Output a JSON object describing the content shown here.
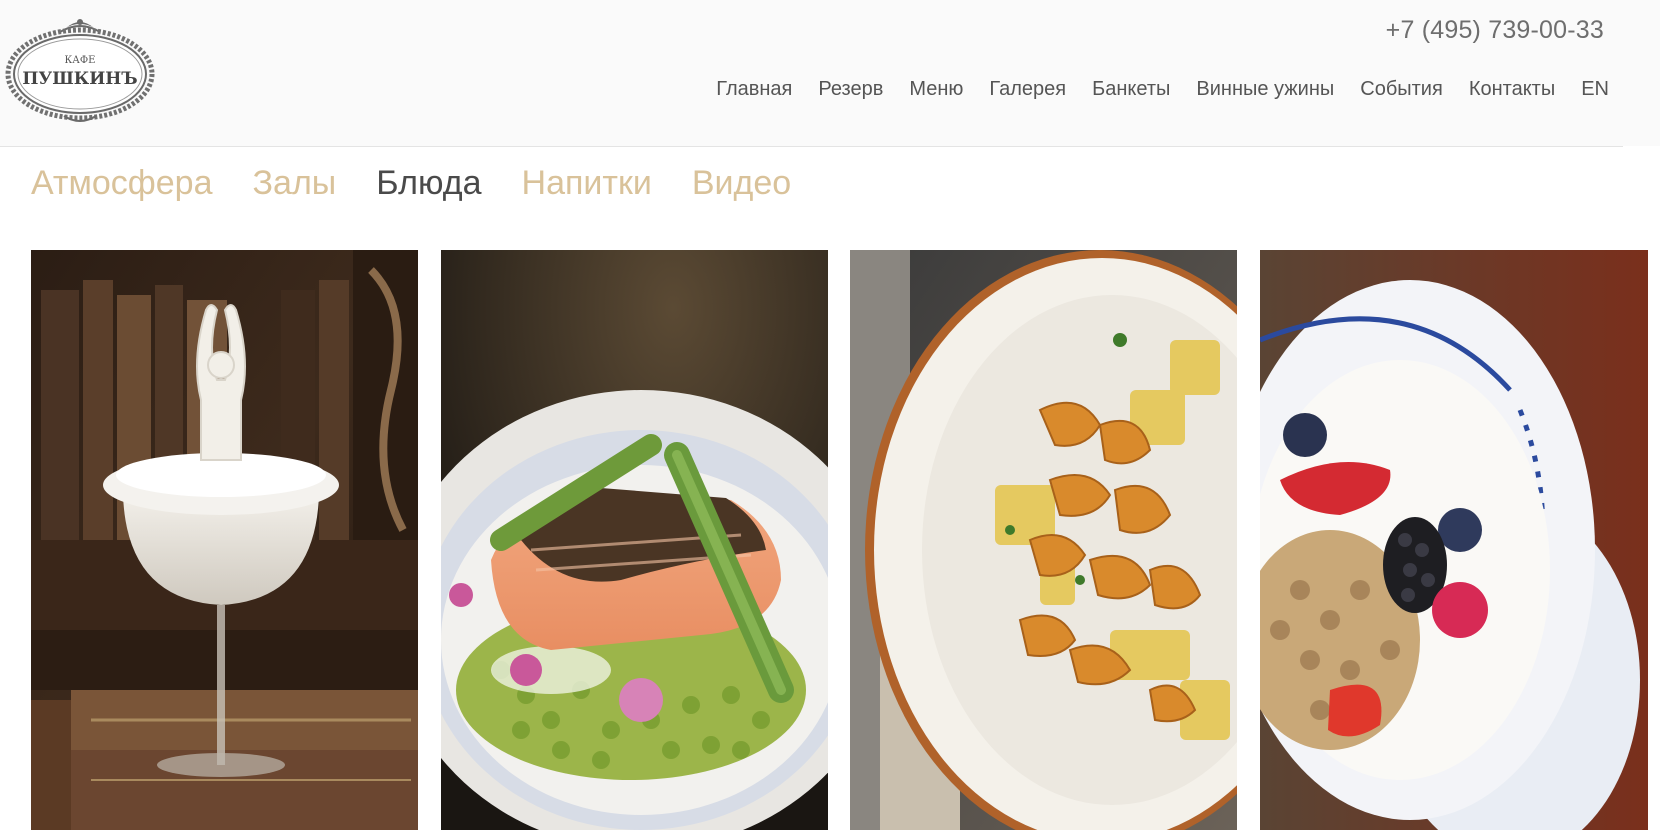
{
  "brand": {
    "logo_small_text": "КАФЕ",
    "logo_main_text": "ПУШКИНЪ"
  },
  "header": {
    "phone": "+7 (495) 739-00-33",
    "nav": [
      {
        "label": "Главная"
      },
      {
        "label": "Резерв"
      },
      {
        "label": "Меню"
      },
      {
        "label": "Галерея"
      },
      {
        "label": "Банкеты"
      },
      {
        "label": "Винные ужины"
      },
      {
        "label": "События"
      },
      {
        "label": "Контакты"
      },
      {
        "label": "EN"
      }
    ]
  },
  "gallery": {
    "tabs": [
      {
        "label": "Атмосфера",
        "active": false
      },
      {
        "label": "Залы",
        "active": false
      },
      {
        "label": "Блюда",
        "active": true
      },
      {
        "label": "Напитки",
        "active": false
      },
      {
        "label": "Видео",
        "active": false
      }
    ],
    "photos": [
      {
        "subject": "ballerina-dessert-cocktail"
      },
      {
        "subject": "salmon-with-asparagus-and-peas"
      },
      {
        "subject": "chanterelles-with-potatoes"
      },
      {
        "subject": "granola-with-yogurt-and-berries"
      }
    ]
  },
  "colors": {
    "tab_inactive": "#d9c29a",
    "tab_active": "#4a4a4a",
    "nav_text": "#555555",
    "header_bg": "#fafafa"
  }
}
